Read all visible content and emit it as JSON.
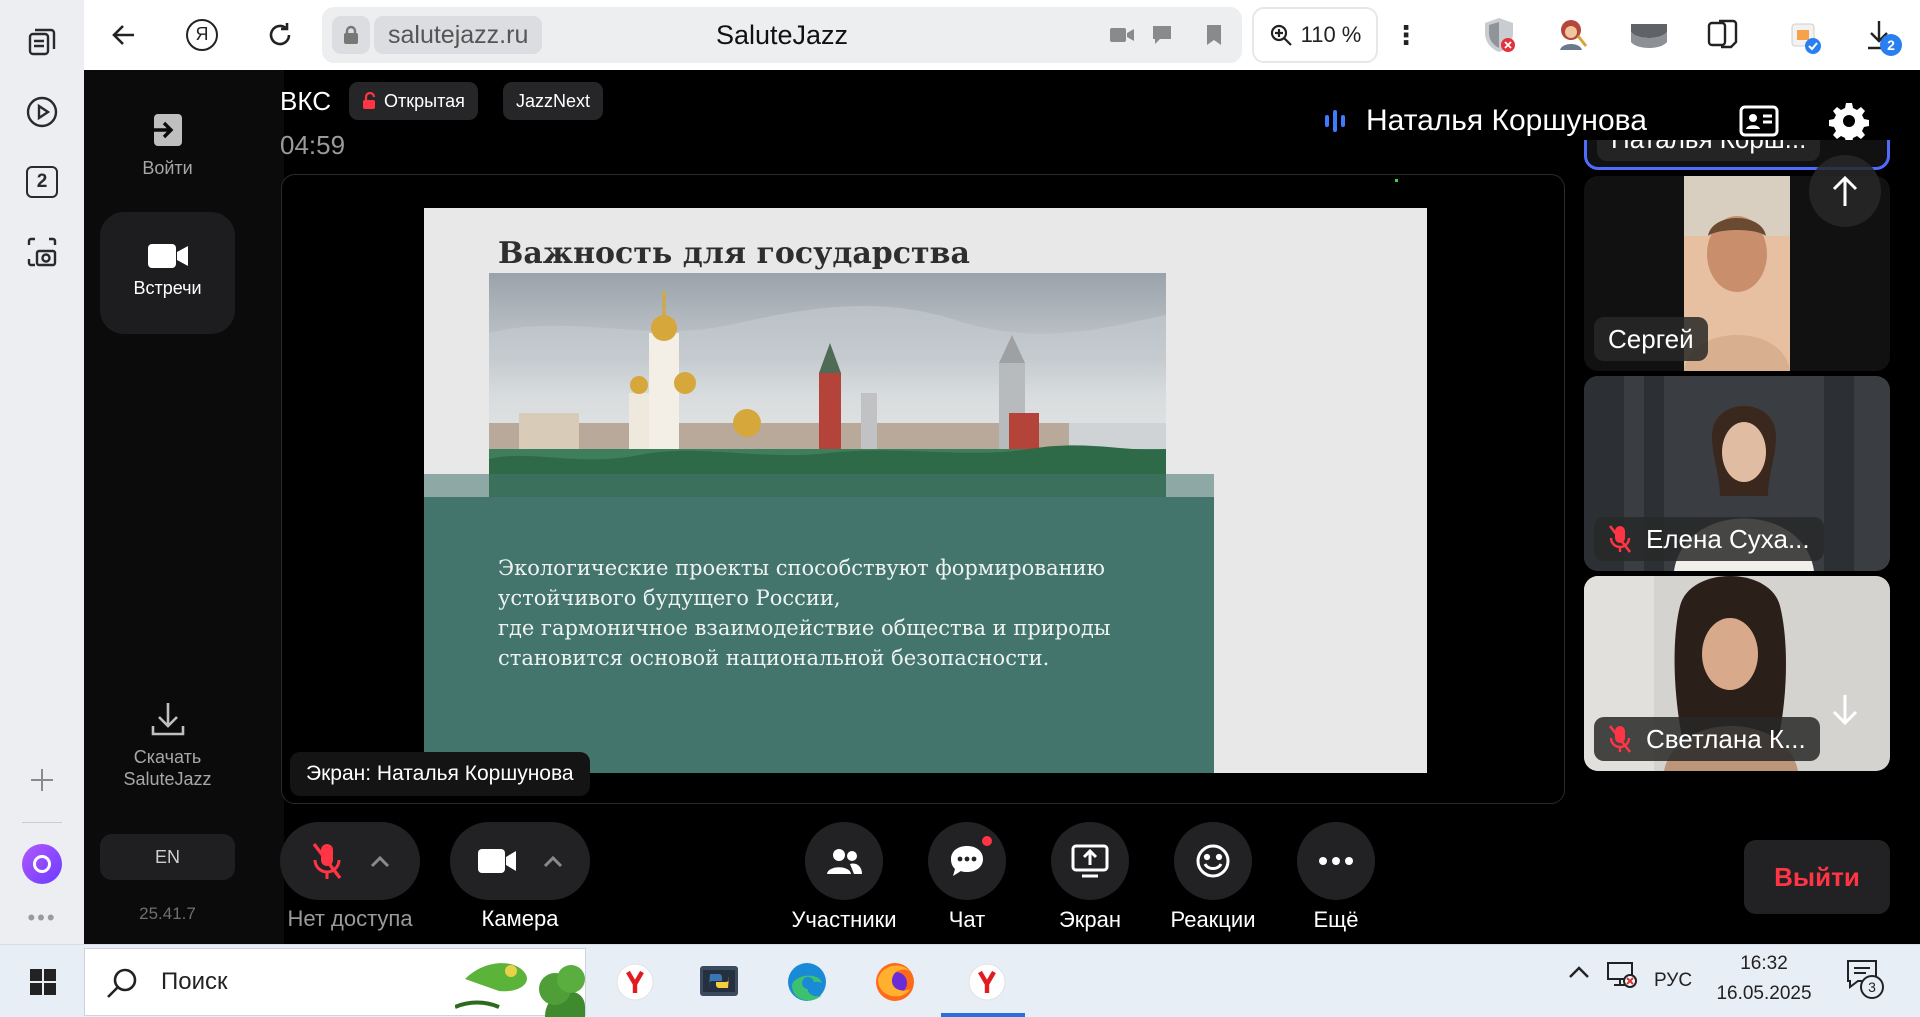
{
  "browser": {
    "domain": "salutejazz.ru",
    "page_title": "SaluteJazz",
    "zoom": "110 %",
    "download_badge": "2",
    "sidebar_badge": "2"
  },
  "app": {
    "nav": {
      "login_label": "Войти",
      "meetings_label": "Встречи",
      "download_label_line1": "Скачать",
      "download_label_line2": "SaluteJazz",
      "lang": "EN",
      "version": "25.41.7"
    },
    "header": {
      "title": "ВКС",
      "badge_open": "Открытая",
      "badge_brand": "JazzNext",
      "timer": "04:59",
      "speaker_name": "Наталья Коршунова"
    },
    "stage": {
      "slide_title": "Важность для государства",
      "slide_lines": [
        "Экологические проекты способствуют формированию",
        "устойчивого будущего России,",
        "где гармоничное взаимодействие общества и природы",
        "становится основой национальной безопасности."
      ],
      "screen_label": "Экран: Наталья Коршунова"
    },
    "tiles": [
      {
        "name": "Наталья Корш..."
      },
      {
        "name": "Сергей"
      },
      {
        "name": "Елена Суха..."
      },
      {
        "name": "Светлана К..."
      }
    ],
    "controls": {
      "mic_label": "Нет доступа",
      "camera_label": "Камера",
      "participants_label": "Участники",
      "chat_label": "Чат",
      "screen_label": "Экран",
      "reactions_label": "Реакции",
      "more_label": "Ещё",
      "exit_label": "Выйти"
    }
  },
  "taskbar": {
    "search_placeholder": "Поиск",
    "lang": "РУС",
    "time": "16:32",
    "date": "16.05.2025",
    "notif_count": "3"
  },
  "colors": {
    "accent_red": "#ff3545",
    "slide_green": "#44756d",
    "speaker_blue": "#3d7bff"
  }
}
